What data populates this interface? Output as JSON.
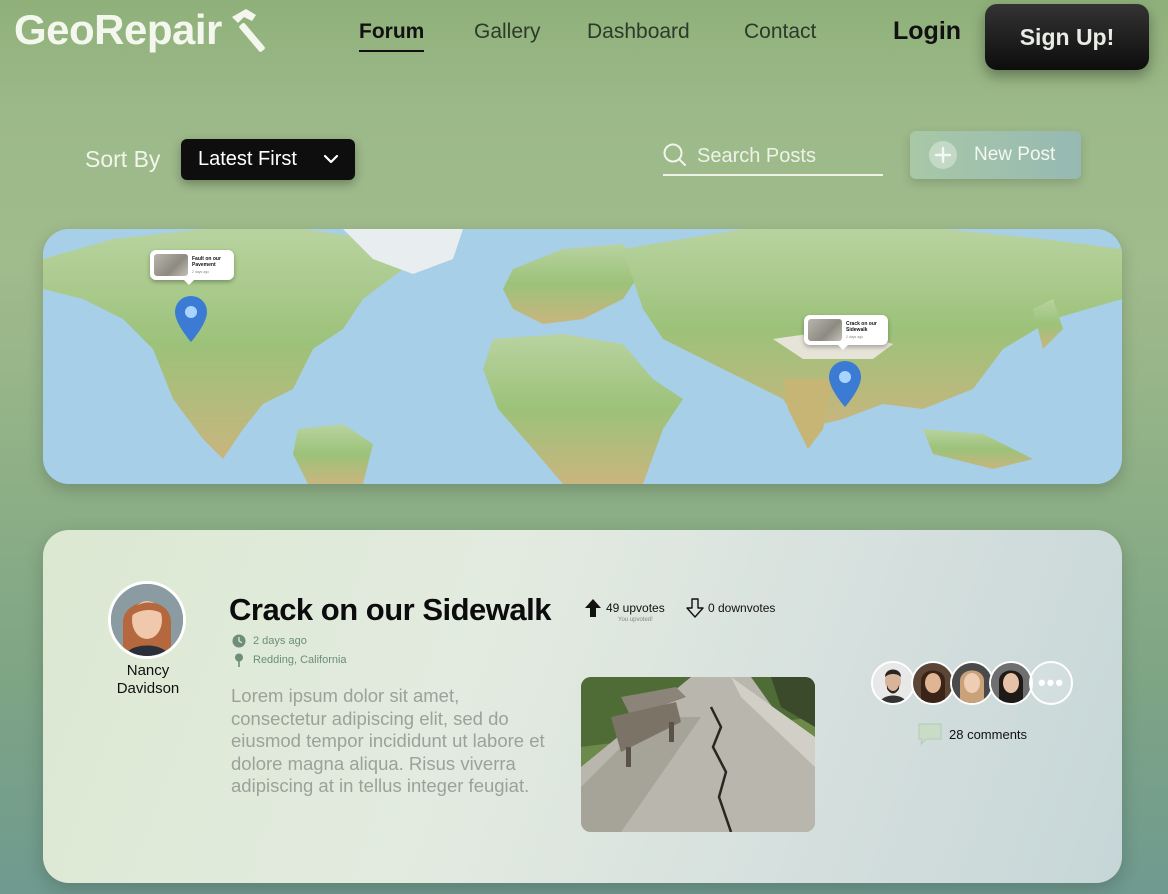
{
  "brand": {
    "name": "GeoRepair",
    "logo_icon": "hammer-icon"
  },
  "nav": {
    "items": [
      {
        "label": "Forum",
        "active": true
      },
      {
        "label": "Gallery",
        "active": false
      },
      {
        "label": "Dashboard",
        "active": false
      },
      {
        "label": "Contact",
        "active": false
      }
    ],
    "login_label": "Login",
    "signup_label": "Sign Up!"
  },
  "toolbar": {
    "sort_label": "Sort By",
    "sort_value": "Latest First",
    "search_placeholder": "Search Posts",
    "new_post_label": "New Post"
  },
  "map": {
    "markers": [
      {
        "title": "Fault on our Pavement",
        "meta": "2 days ago"
      },
      {
        "title": "Crack on our Sidewalk",
        "meta": "2 days ago"
      }
    ]
  },
  "post": {
    "author_first": "Nancy",
    "author_last": "Davidson",
    "title": "Crack on our Sidewalk",
    "upvotes": "49 upvotes",
    "upvote_note": "You upvoted!",
    "downvotes": "0 downvotes",
    "time": "2 days ago",
    "location": "Redding, California",
    "body": "Lorem ipsum dolor sit amet, consectetur adipiscing elit, sed do eiusmod tempor incididunt ut labore et dolore magna aliqua. Risus viverra adipiscing at in tellus integer feugiat.",
    "more_label": "•••",
    "comments": "28 comments"
  },
  "colors": {
    "accent_dark": "#0e0e0e",
    "background": "#9cb989",
    "pin": "#3b7bd4"
  }
}
